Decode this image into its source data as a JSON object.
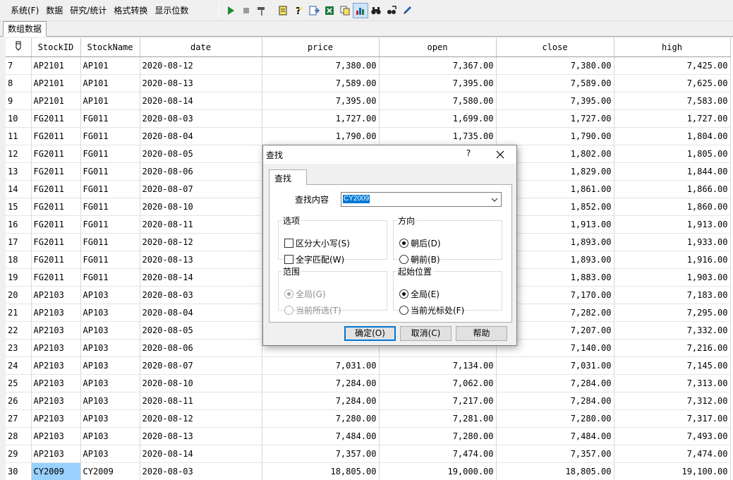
{
  "menu": [
    "系统(F)",
    "数据",
    "研究/统计",
    "格式转换",
    "显示位数"
  ],
  "toolbar": {
    "icons": [
      "play-icon",
      "stop-icon",
      "hammer-icon",
      "document-icon",
      "help-icon",
      "export-icon",
      "excel-icon",
      "copy-icon",
      "chart-icon",
      "binoculars-icon",
      "find-replace-icon",
      "pen-icon"
    ]
  },
  "tab": {
    "label": "数组数据"
  },
  "grid": {
    "columns": [
      "StockID",
      "StockName",
      "date",
      "price",
      "open",
      "close",
      "high"
    ],
    "rows": [
      [
        "7",
        "AP2101",
        "AP101",
        "2020-08-12",
        "7,380.00",
        "7,367.00",
        "7,380.00",
        "7,425.00"
      ],
      [
        "8",
        "AP2101",
        "AP101",
        "2020-08-13",
        "7,589.00",
        "7,395.00",
        "7,589.00",
        "7,625.00"
      ],
      [
        "9",
        "AP2101",
        "AP101",
        "2020-08-14",
        "7,395.00",
        "7,580.00",
        "7,395.00",
        "7,583.00"
      ],
      [
        "10",
        "FG2011",
        "FG011",
        "2020-08-03",
        "1,727.00",
        "1,699.00",
        "1,727.00",
        "1,727.00"
      ],
      [
        "11",
        "FG2011",
        "FG011",
        "2020-08-04",
        "1,790.00",
        "1,735.00",
        "1,790.00",
        "1,804.00"
      ],
      [
        "12",
        "FG2011",
        "FG011",
        "2020-08-05",
        "",
        "",
        "1,802.00",
        "1,805.00"
      ],
      [
        "13",
        "FG2011",
        "FG011",
        "2020-08-06",
        "",
        "",
        "1,829.00",
        "1,844.00"
      ],
      [
        "14",
        "FG2011",
        "FG011",
        "2020-08-07",
        "",
        "",
        "1,861.00",
        "1,866.00"
      ],
      [
        "15",
        "FG2011",
        "FG011",
        "2020-08-10",
        "",
        "",
        "1,852.00",
        "1,860.00"
      ],
      [
        "16",
        "FG2011",
        "FG011",
        "2020-08-11",
        "",
        "",
        "1,913.00",
        "1,913.00"
      ],
      [
        "17",
        "FG2011",
        "FG011",
        "2020-08-12",
        "",
        "",
        "1,893.00",
        "1,933.00"
      ],
      [
        "18",
        "FG2011",
        "FG011",
        "2020-08-13",
        "",
        "",
        "1,893.00",
        "1,916.00"
      ],
      [
        "19",
        "FG2011",
        "FG011",
        "2020-08-14",
        "",
        "",
        "1,883.00",
        "1,903.00"
      ],
      [
        "20",
        "AP2103",
        "AP103",
        "2020-08-03",
        "",
        "",
        "7,170.00",
        "7,183.00"
      ],
      [
        "21",
        "AP2103",
        "AP103",
        "2020-08-04",
        "",
        "",
        "7,282.00",
        "7,295.00"
      ],
      [
        "22",
        "AP2103",
        "AP103",
        "2020-08-05",
        "",
        "",
        "7,207.00",
        "7,332.00"
      ],
      [
        "23",
        "AP2103",
        "AP103",
        "2020-08-06",
        "",
        "",
        "7,140.00",
        "7,216.00"
      ],
      [
        "24",
        "AP2103",
        "AP103",
        "2020-08-07",
        "7,031.00",
        "7,134.00",
        "7,031.00",
        "7,145.00"
      ],
      [
        "25",
        "AP2103",
        "AP103",
        "2020-08-10",
        "7,284.00",
        "7,062.00",
        "7,284.00",
        "7,313.00"
      ],
      [
        "26",
        "AP2103",
        "AP103",
        "2020-08-11",
        "7,284.00",
        "7,217.00",
        "7,284.00",
        "7,312.00"
      ],
      [
        "27",
        "AP2103",
        "AP103",
        "2020-08-12",
        "7,280.00",
        "7,281.00",
        "7,280.00",
        "7,317.00"
      ],
      [
        "28",
        "AP2103",
        "AP103",
        "2020-08-13",
        "7,484.00",
        "7,280.00",
        "7,484.00",
        "7,493.00"
      ],
      [
        "29",
        "AP2103",
        "AP103",
        "2020-08-14",
        "7,357.00",
        "7,474.00",
        "7,357.00",
        "7,474.00"
      ],
      [
        "30",
        "CY2009",
        "CY2009",
        "2020-08-03",
        "18,805.00",
        "19,000.00",
        "18,805.00",
        "19,100.00"
      ]
    ],
    "selected_row": 30
  },
  "dialog": {
    "title": "查找",
    "help": "?",
    "tab": "查找",
    "find_label": "查找内容",
    "find_value": "CY2009",
    "options": {
      "legend": "选项",
      "match_case": "区分大小写(S)",
      "whole_word": "全字匹配(W)"
    },
    "direction": {
      "legend": "方向",
      "forward": "朝后(D)",
      "backward": "朝前(B)"
    },
    "scope": {
      "legend": "范围",
      "all": "全局(G)",
      "selection": "当前所选(T)"
    },
    "origin": {
      "legend": "起始位置",
      "all": "全局(E)",
      "cursor": "当前光标处(F)"
    },
    "buttons": {
      "ok": "确定(O)",
      "cancel": "取消(C)",
      "help": "帮助"
    }
  }
}
